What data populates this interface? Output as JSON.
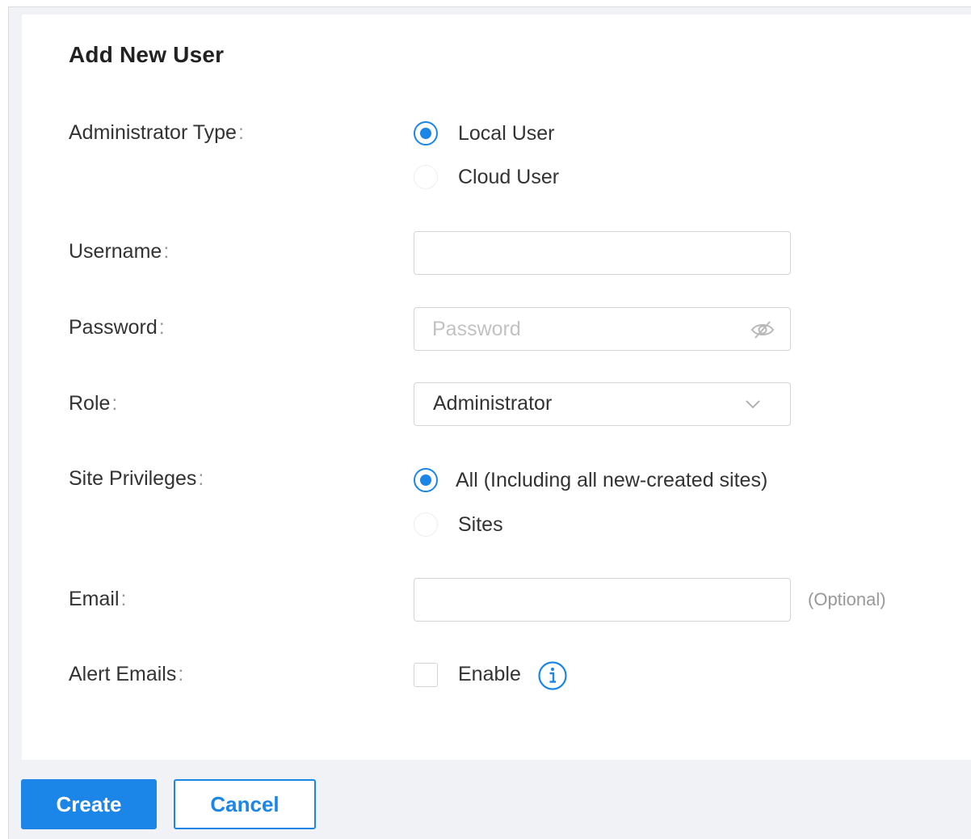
{
  "dialog": {
    "title": "Add New User"
  },
  "form": {
    "colon": ":",
    "administrator_type": {
      "label": "Administrator Type",
      "options": [
        {
          "label": "Local User",
          "selected": true
        },
        {
          "label": "Cloud User",
          "selected": false
        }
      ]
    },
    "username": {
      "label": "Username",
      "value": "",
      "placeholder": ""
    },
    "password": {
      "label": "Password",
      "value": "",
      "placeholder": "Password",
      "toggle_icon": "eye-hidden-icon"
    },
    "role": {
      "label": "Role",
      "selected": "Administrator",
      "icon": "chevron-down-icon"
    },
    "site_privileges": {
      "label": "Site Privileges",
      "options": [
        {
          "label": "All (Including all new-created sites)",
          "selected": true
        },
        {
          "label": "Sites",
          "selected": false
        }
      ]
    },
    "email": {
      "label": "Email",
      "value": "",
      "placeholder": "",
      "hint": "(Optional)"
    },
    "alert_emails": {
      "label": "Alert Emails",
      "checkbox_label": "Enable",
      "checked": false,
      "info_icon": "info-icon"
    }
  },
  "footer": {
    "create_label": "Create",
    "cancel_label": "Cancel"
  },
  "colors": {
    "accent": "#1c86e8",
    "label_text": "#333333",
    "muted_text": "#999999",
    "border": "#d4d4d4",
    "footer_bg": "#f0f2f5"
  }
}
